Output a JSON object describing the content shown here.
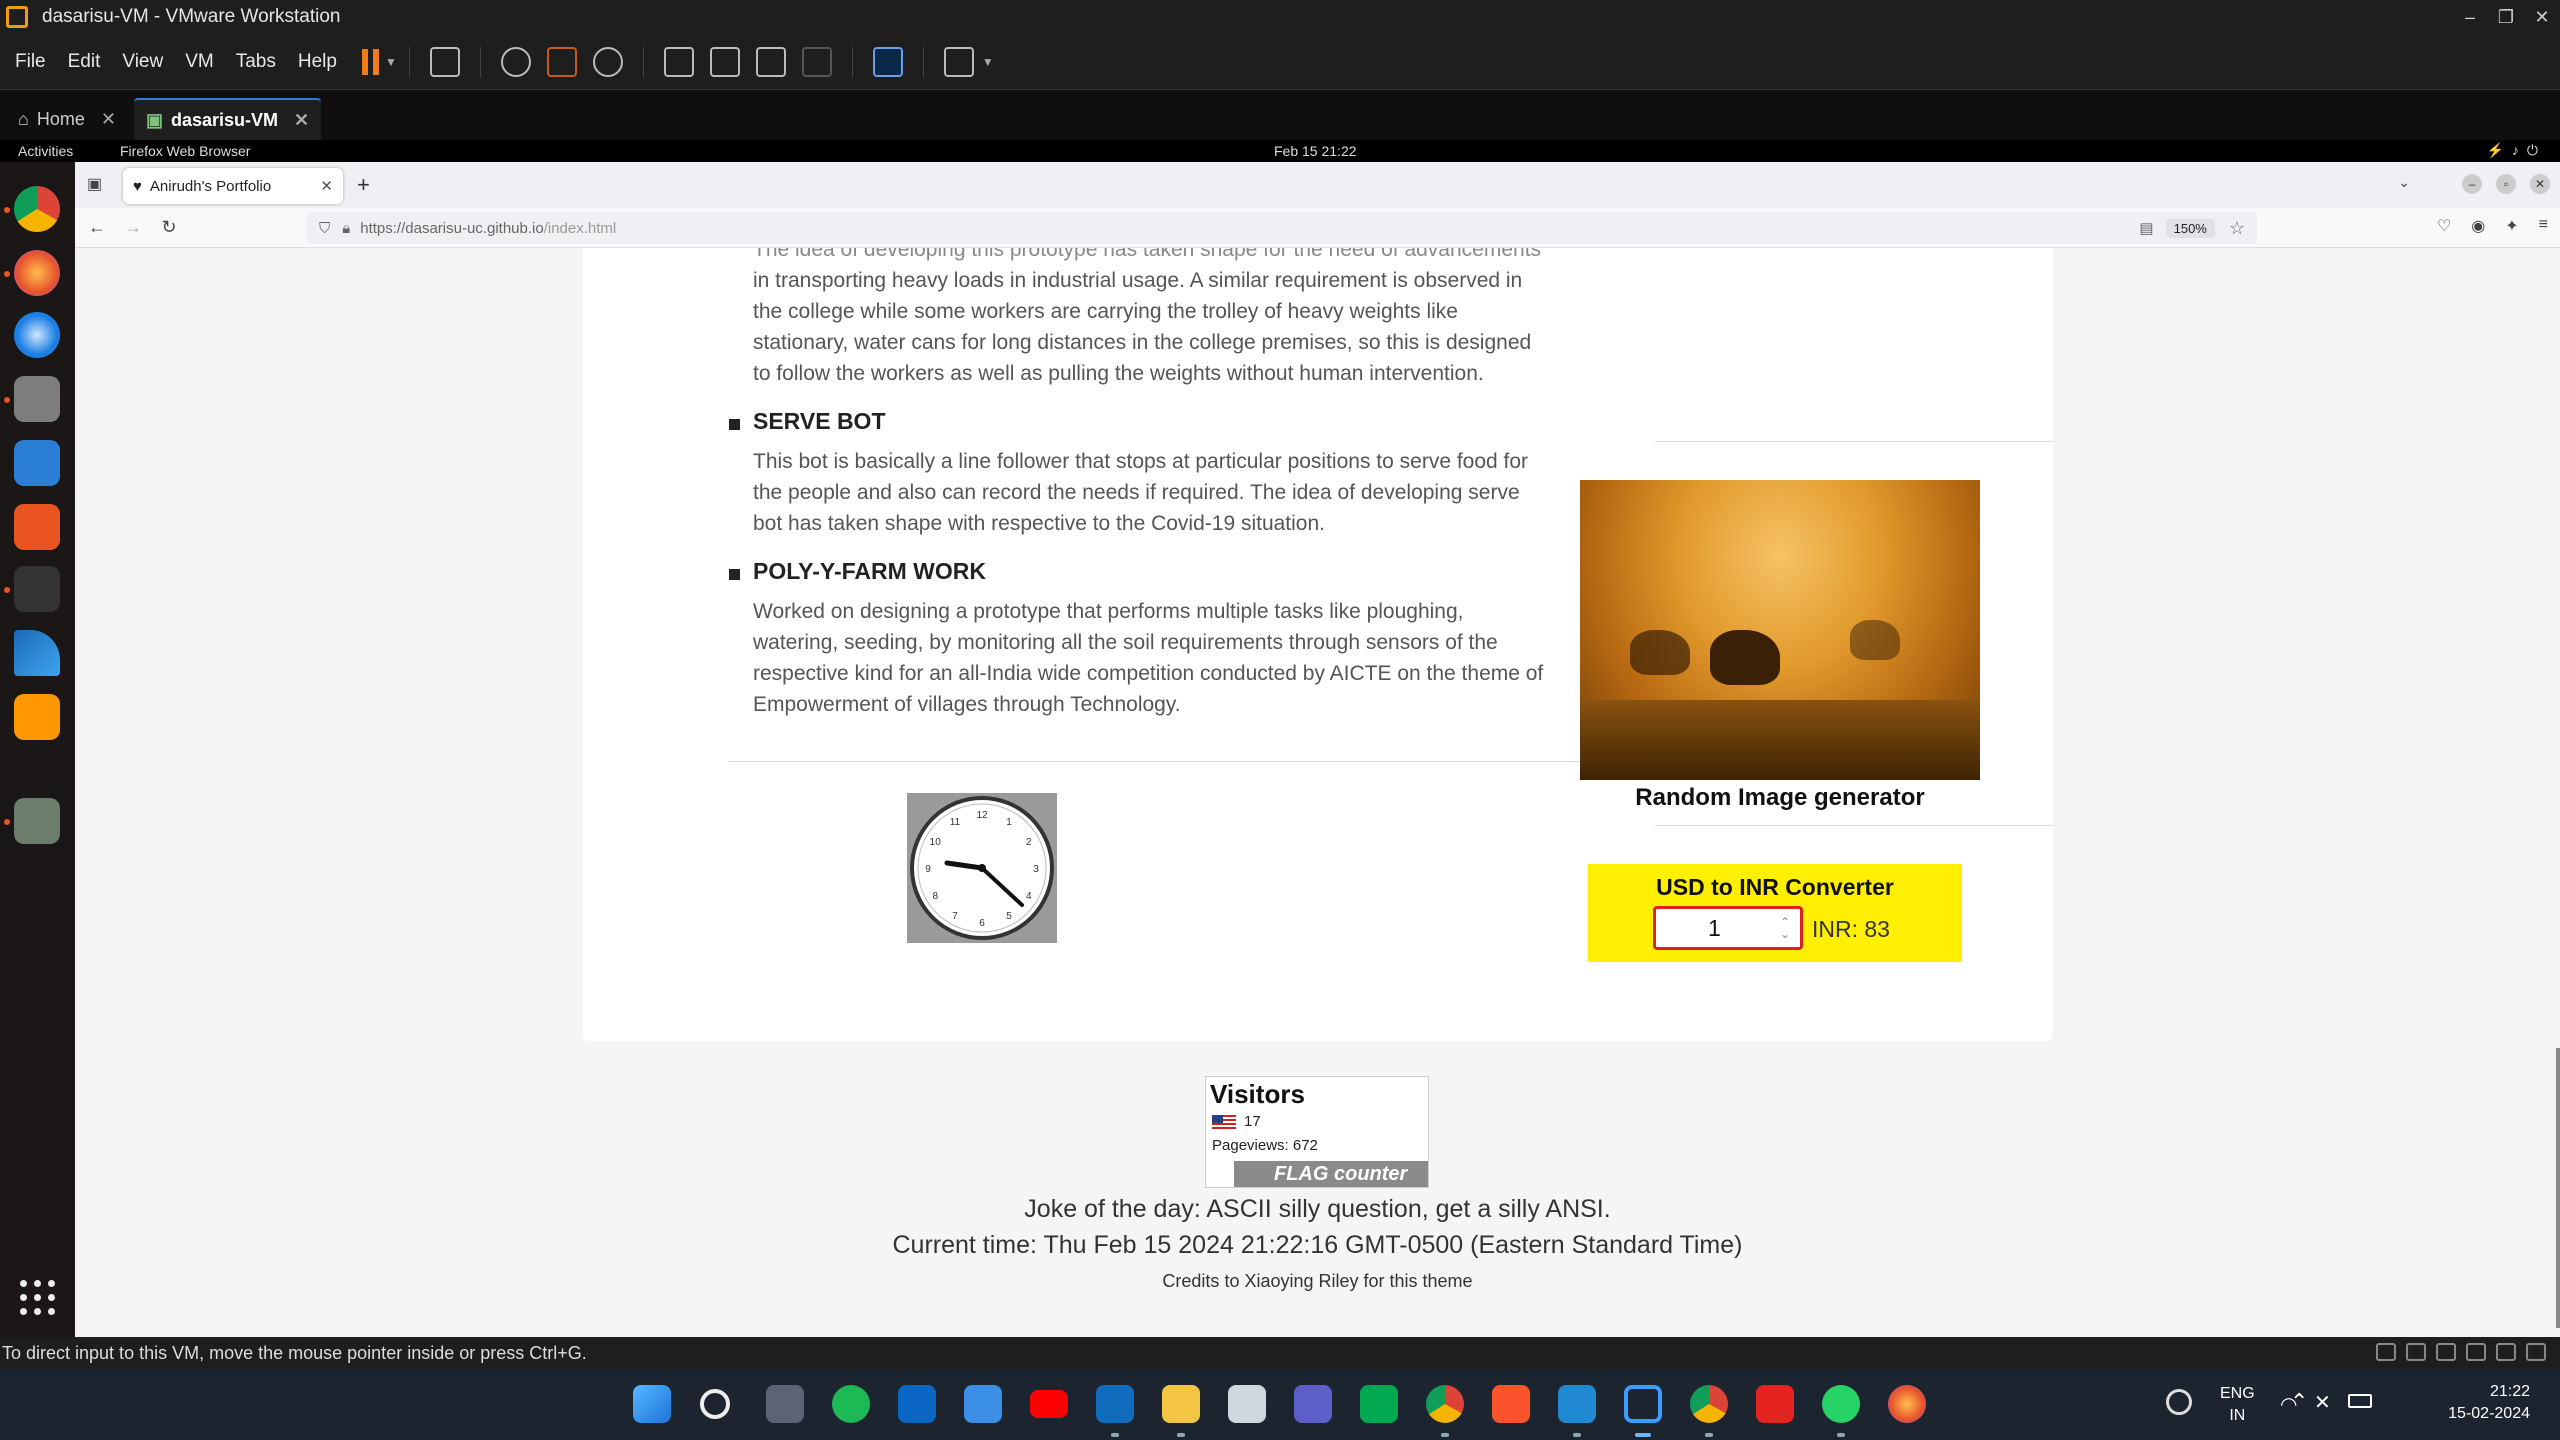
{
  "vm": {
    "title": "dasarisu-VM - VMware Workstation",
    "menu": [
      "File",
      "Edit",
      "View",
      "VM",
      "Tabs",
      "Help"
    ],
    "tabs": [
      {
        "label": "Home"
      },
      {
        "label": "dasarisu-VM"
      }
    ],
    "status_text": "To direct input to this VM, move the mouse pointer inside or press Ctrl+G."
  },
  "gnome": {
    "activities": "Activities",
    "app_name": "Firefox Web Browser",
    "clock": "Feb 15  21:22"
  },
  "dock_apps": [
    "chrome-icon",
    "firefox-icon",
    "thunderbird-icon",
    "files-icon",
    "writer-icon",
    "software-icon",
    "terminal-icon",
    "wireshark-icon",
    "sublime-icon",
    "trash-icon"
  ],
  "browser": {
    "tab_title": "Anirudh's Portfolio",
    "url_host": "https://dasarisu-uc.github.io",
    "url_path": "/index.html",
    "zoom": "150%"
  },
  "content": {
    "intro_lines": [
      "The idea of developing this prototype has taken shape for the need of advancements",
      "in transporting heavy loads in industrial usage. A similar requirement is observed in",
      "the college while some workers are carrying the trolley of heavy weights like",
      "stationary, water cans for long distances in the college premises, so this is designed",
      "to follow the workers as well as pulling the weights without human intervention."
    ],
    "projects": [
      {
        "title": "SERVE BOT",
        "lines": [
          "This bot is basically a line follower that stops at particular positions to serve food for",
          "the people and also can record the needs if required. The idea of developing serve",
          "bot has taken shape with respective to the Covid-19 situation."
        ]
      },
      {
        "title": "POLY-Y-FARM WORK",
        "lines": [
          "Worked on designing a prototype that performs multiple tasks like ploughing,",
          "watering, seeding, by monitoring all the soil requirements through sensors of the",
          "respective kind for an all-India wide competition conducted by AICTE on the theme of",
          "Empowerment of villages through Technology."
        ]
      }
    ],
    "clock_numbers": [
      "12",
      "1",
      "2",
      "3",
      "4",
      "5",
      "6",
      "7",
      "8",
      "9",
      "10",
      "11"
    ],
    "random_image_caption": "Random Image generator",
    "converter": {
      "title": "USD to INR Converter",
      "usd_value": "1",
      "inr_output": "INR: 83"
    },
    "visitors": {
      "title": "Visitors",
      "count": "17",
      "pageviews": "Pageviews:  672",
      "brand": "FLAG counter"
    },
    "joke": "Joke of the day: ASCII silly question, get a silly ANSI.",
    "current_time": "Current time: Thu Feb 15 2024 21:22:16 GMT-0500 (Eastern Standard Time)",
    "credits": "Credits to Xiaoying Riley for this theme"
  },
  "taskbar": {
    "apps": [
      "windows-start-icon",
      "search-icon",
      "calculator-icon",
      "spotify-icon",
      "linkedin-icon",
      "mail-icon",
      "youtube-icon",
      "outlook-icon",
      "file-explorer-icon",
      "wolfram-icon",
      "teams-icon",
      "meet-icon",
      "chrome-icon",
      "brave-icon",
      "vscode-icon",
      "vmware-icon",
      "chrome-profile-icon",
      "acrobat-icon",
      "whatsapp-icon",
      "firefox-icon"
    ],
    "lang_top": "ENG",
    "lang_bottom": "IN",
    "time": "21:22",
    "date": "15-02-2024"
  },
  "colors": {
    "converter_bg": "#ffef00",
    "input_border": "#e0201b",
    "vm_accent": "#f07d1a"
  }
}
